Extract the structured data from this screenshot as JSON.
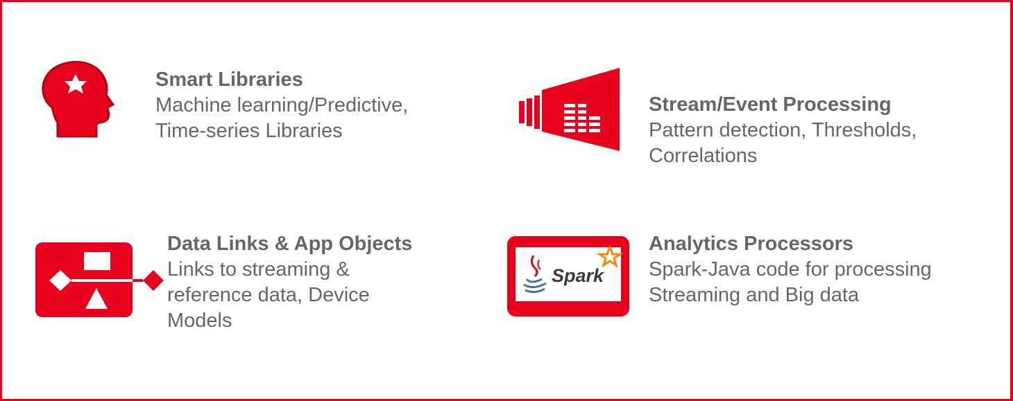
{
  "colors": {
    "accent": "#e8001c",
    "text": "#666666"
  },
  "features": [
    {
      "icon": "head-star-icon",
      "title": "Smart Libraries",
      "lines": [
        "Machine learning/Predictive,",
        "Time-series Libraries"
      ]
    },
    {
      "icon": "stream-bars-icon",
      "title": "Stream/Event Processing",
      "lines": [
        "Pattern detection, Thresholds,",
        "Correlations"
      ]
    },
    {
      "icon": "data-flow-shapes-icon",
      "title": "Data Links & App Objects",
      "lines": [
        "Links to streaming &",
        "reference data, Device",
        "Models"
      ]
    },
    {
      "icon": "spark-java-logo-icon",
      "logo_text": "Spark",
      "title": "Analytics Processors",
      "lines": [
        "Spark-Java code for processing",
        "Streaming and Big data"
      ]
    }
  ]
}
